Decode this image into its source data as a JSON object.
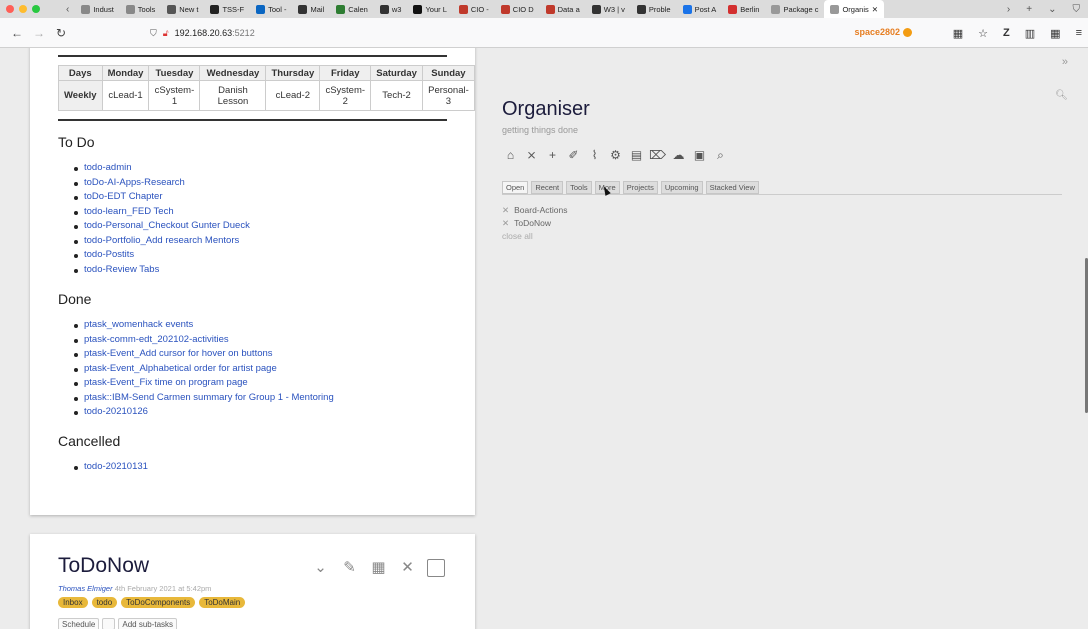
{
  "browser": {
    "tabs": [
      {
        "label": "Indust",
        "fav_color": "#888"
      },
      {
        "label": "Tools",
        "fav_color": "#888"
      },
      {
        "label": "New t",
        "fav_color": "#555"
      },
      {
        "label": "TSS-F",
        "fav_color": "#222"
      },
      {
        "label": "Tool -",
        "fav_color": "#0a66c2"
      },
      {
        "label": "Mail",
        "fav_color": "#333"
      },
      {
        "label": "Calen",
        "fav_color": "#2e7d32"
      },
      {
        "label": "w3",
        "fav_color": "#333"
      },
      {
        "label": "Your L",
        "fav_color": "#111"
      },
      {
        "label": "CIO -",
        "fav_color": "#c0392b"
      },
      {
        "label": "CIO D",
        "fav_color": "#c0392b"
      },
      {
        "label": "Data a",
        "fav_color": "#c0392b"
      },
      {
        "label": "W3 | v",
        "fav_color": "#333"
      },
      {
        "label": "Proble",
        "fav_color": "#333"
      },
      {
        "label": "Post A",
        "fav_color": "#1a73e8"
      },
      {
        "label": "Berlin",
        "fav_color": "#d32f2f"
      },
      {
        "label": "Package c",
        "fav_color": "#999"
      },
      {
        "label": "Organis",
        "fav_color": "#999",
        "active": true
      }
    ],
    "url_host": "192.168.20.63",
    "url_port": ":5212",
    "space_label": "space2802"
  },
  "schedule": {
    "headers": [
      "Days",
      "Monday",
      "Tuesday",
      "Wednesday",
      "Thursday",
      "Friday",
      "Saturday",
      "Sunday"
    ],
    "row_label": "Weekly",
    "cells": [
      "cLead-1",
      "cSystem-1",
      "Danish Lesson",
      "cLead-2",
      "cSystem-2",
      "Tech-2",
      "Personal-3"
    ]
  },
  "sections": {
    "todo_title": "To Do",
    "todo_items": [
      "todo-admin",
      "toDo-AI-Apps-Research",
      "toDo-EDT Chapter",
      "todo-learn_FED Tech",
      "todo-Personal_Checkout Gunter Dueck",
      "todo-Portfolio_Add research Mentors",
      "todo-Postits",
      "todo-Review Tabs"
    ],
    "done_title": "Done",
    "done_items": [
      "ptask_womenhack events",
      "ptask-comm-edt_202102-activities",
      "ptask-Event_Add cursor for hover on buttons",
      "ptask-Event_Alphabetical order for artist page",
      "ptask-Event_Fix time on program page",
      "ptask::IBM-Send Carmen summary for Group 1 - Mentoring",
      "todo-20210126"
    ],
    "cancelled_title": "Cancelled",
    "cancelled_items": [
      "todo-20210131"
    ]
  },
  "todonow": {
    "title": "ToDoNow",
    "author": "Thomas Elmiger",
    "date": "4th February 2021 at 5:42pm",
    "tags": [
      "Inbox",
      "todo",
      "ToDoComponents",
      "ToDoMain"
    ],
    "buttons": [
      "Schedule",
      "",
      "Add sub-tasks"
    ]
  },
  "sidebar": {
    "title": "Organiser",
    "subtitle": "getting things done",
    "tabs": [
      "Open",
      "Recent",
      "Tools",
      "More",
      "Projects",
      "Upcoming",
      "Stacked View"
    ],
    "open_items": [
      "Board-Actions",
      "ToDoNow"
    ],
    "close_all": "close all"
  },
  "colors": {
    "link": "#2a52be",
    "tag": "#e8b83a",
    "space": "#e67e22"
  }
}
